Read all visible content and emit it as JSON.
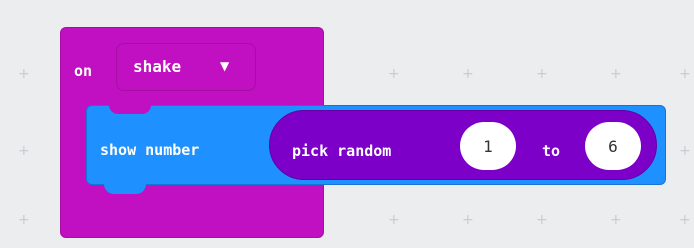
{
  "workspace": {
    "background": "#ecedee",
    "grid_glyph": "+"
  },
  "event_block": {
    "keyword": "on",
    "dropdown_value": "shake",
    "dropdown_caret": "▼",
    "color": "#c110c1"
  },
  "statement_block": {
    "label": "show number",
    "color": "#1e90ff"
  },
  "reporter_block": {
    "label": "pick random",
    "from_value": "1",
    "to_label": "to",
    "to_value": "6",
    "color": "#7d00c9"
  }
}
